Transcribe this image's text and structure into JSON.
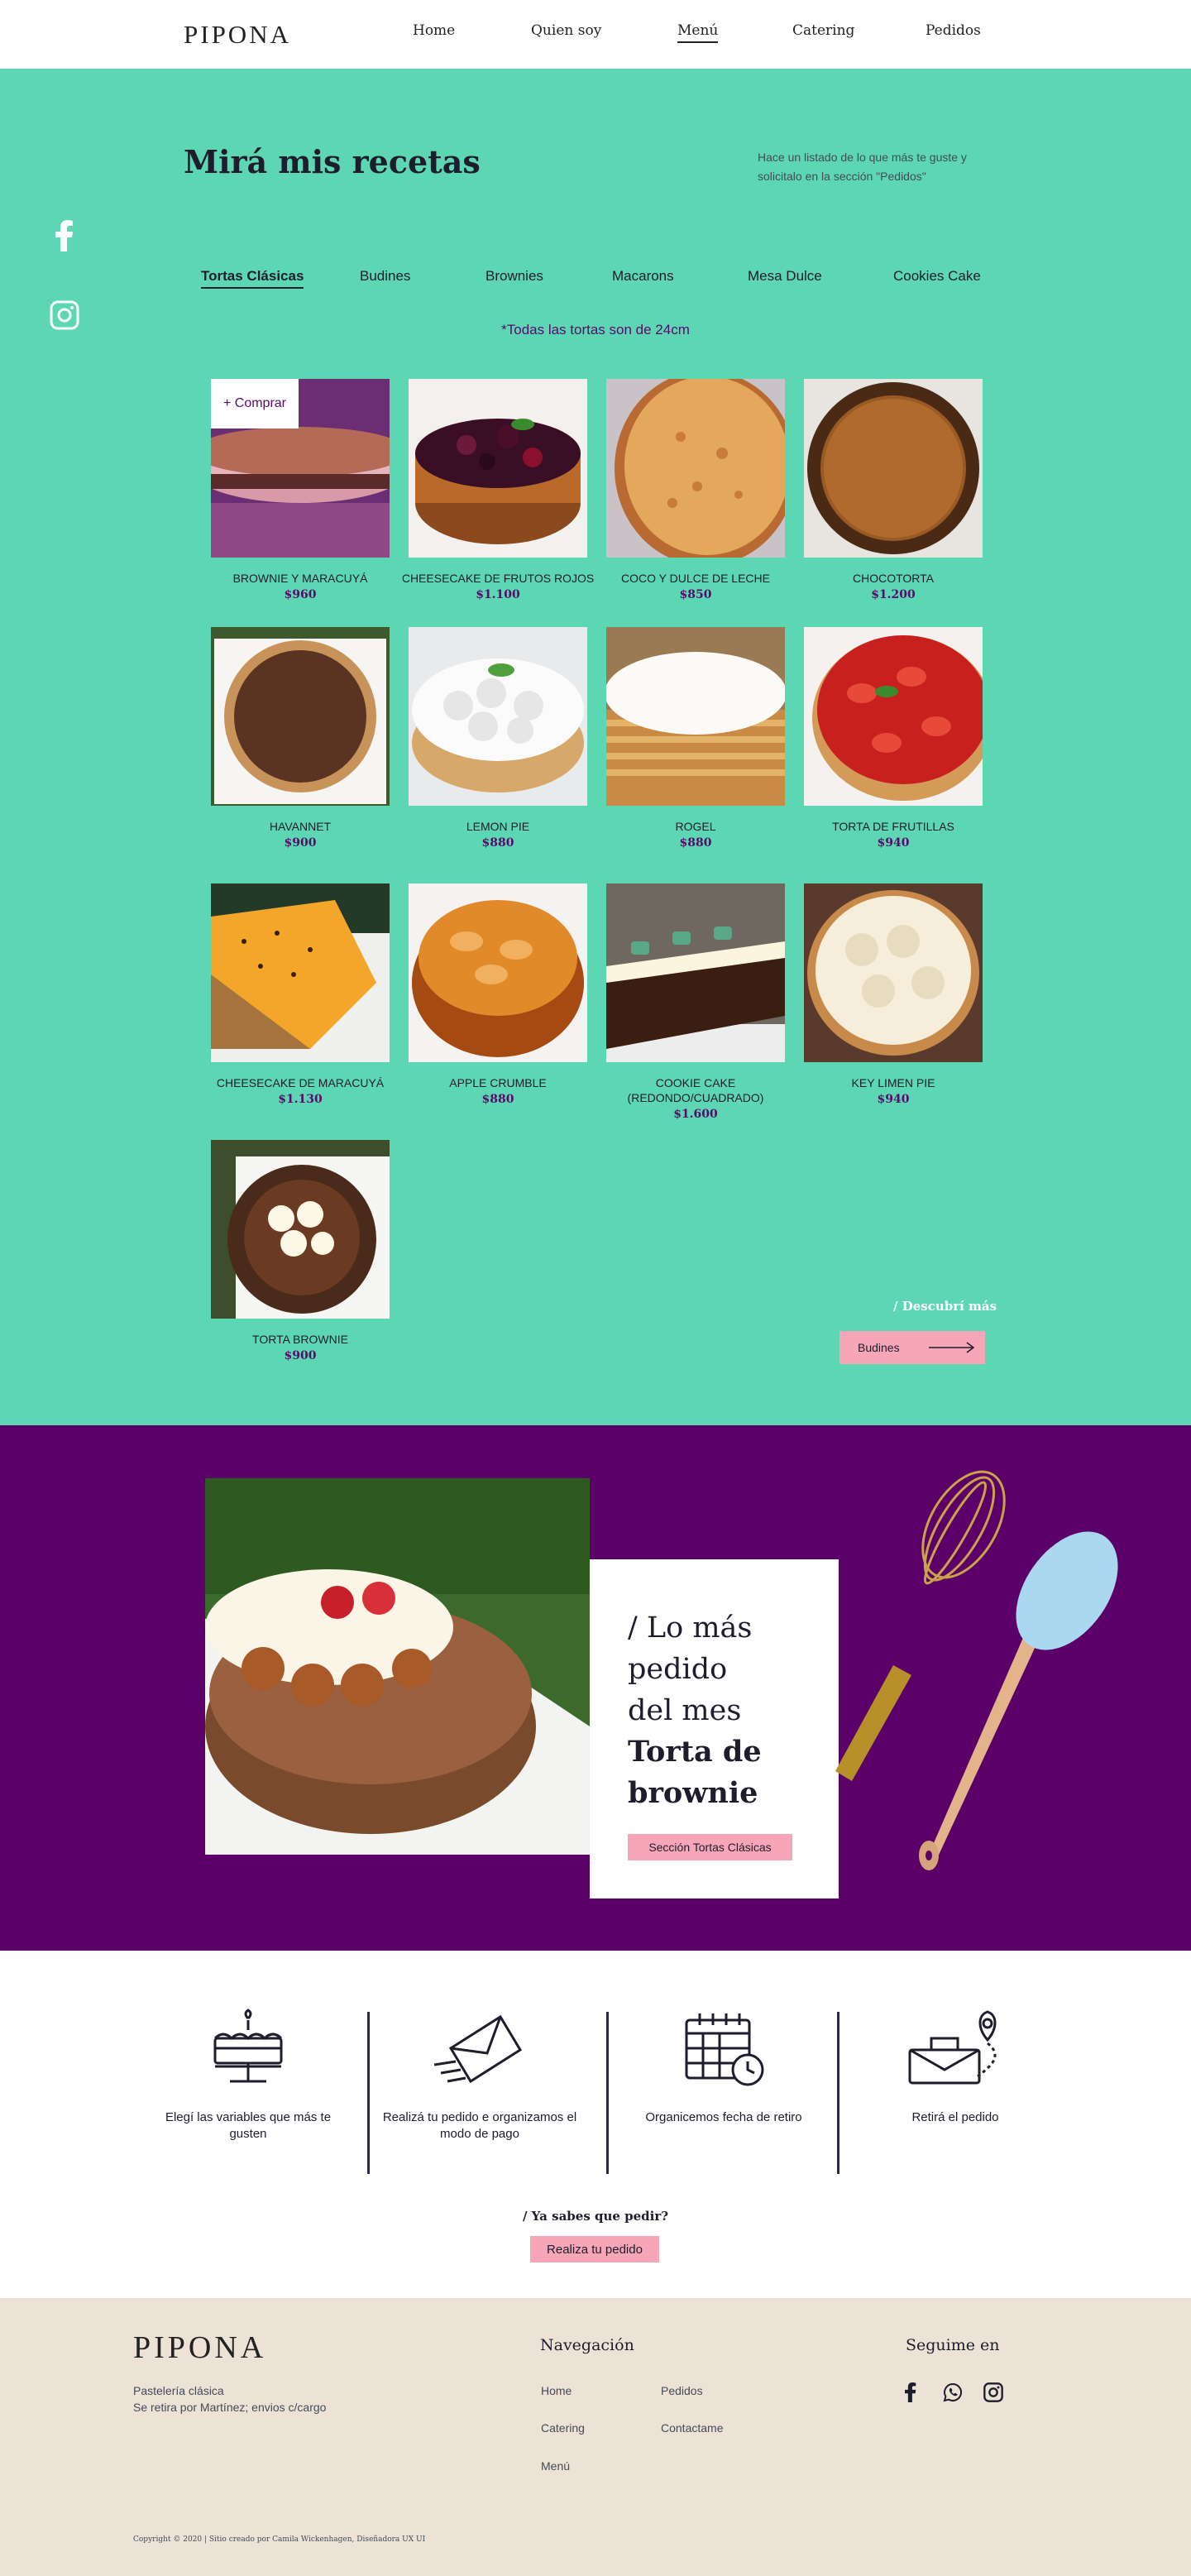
{
  "header": {
    "logo": "PIPONA",
    "nav": [
      {
        "label": "Home"
      },
      {
        "label": "Quien soy"
      },
      {
        "label": "Menú"
      },
      {
        "label": "Catering"
      },
      {
        "label": "Pedidos"
      }
    ],
    "active_nav": "Menú"
  },
  "menu": {
    "title": "Mirá mis recetas",
    "intro": "Hace un listado de lo que más te guste y solicitalo en la sección \"Pedidos\"",
    "tabs": [
      {
        "label": "Tortas Clásicas"
      },
      {
        "label": "Budines"
      },
      {
        "label": "Brownies"
      },
      {
        "label": "Macarons"
      },
      {
        "label": "Mesa Dulce"
      },
      {
        "label": "Cookies Cake"
      }
    ],
    "active_tab": "Tortas Clásicas",
    "size_note": "*Todas las tortas son de 24cm",
    "buy_label": "+ Comprar",
    "products": [
      {
        "name": "BROWNIE Y MARACUYÁ",
        "price": "$960"
      },
      {
        "name": "CHEESECAKE DE FRUTOS ROJOS",
        "price": "$1.100"
      },
      {
        "name": "COCO Y DULCE DE LECHE",
        "price": "$850"
      },
      {
        "name": "CHOCOTORTA",
        "price": "$1.200"
      },
      {
        "name": "HAVANNET",
        "price": "$900"
      },
      {
        "name": "LEMON PIE",
        "price": "$880"
      },
      {
        "name": "ROGEL",
        "price": "$880"
      },
      {
        "name": "TORTA DE FRUTILLAS",
        "price": "$940"
      },
      {
        "name": "CHEESECAKE DE MARACUYÁ",
        "price": "$1.130"
      },
      {
        "name": "APPLE CRUMBLE",
        "price": "$880"
      },
      {
        "name": "COOKIE CAKE (REDONDO/CUADRADO)",
        "price": "$1.600"
      },
      {
        "name": "KEY LIMEN PIE",
        "price": "$940"
      },
      {
        "name": "TORTA BROWNIE",
        "price": "$900"
      }
    ],
    "discover_label": "/ Descubrí más",
    "next_button": "Budines"
  },
  "featured": {
    "line1": "/ Lo más",
    "line2": "pedido",
    "line3": "del mes",
    "line4": "Torta de",
    "line5": "brownie",
    "button": "Sección Tortas Clásicas"
  },
  "steps": {
    "items": [
      {
        "text": "Elegí las variables que más te gusten",
        "icon": "cake-icon"
      },
      {
        "text": "Realizá tu pedido e organizamos el modo de pago",
        "icon": "envelope-icon"
      },
      {
        "text": "Organicemos fecha de retiro",
        "icon": "calendar-icon"
      },
      {
        "text": "Retirá el pedido",
        "icon": "delivery-icon"
      }
    ],
    "question": "/ Ya sabes que pedir?",
    "button": "Realiza tu pedido"
  },
  "footer": {
    "logo": "PIPONA",
    "tagline": "Pastelería clásica",
    "pickup": "Se retira por Martínez; envios c/cargo",
    "nav_heading": "Navegación",
    "links": {
      "home": "Home",
      "pedidos": "Pedidos",
      "catering": "Catering",
      "contactame": "Contactame",
      "menu": "Menú"
    },
    "follow_heading": "Seguime en",
    "copyright": "Copyright © 2020 | Sitio creado por Camila Wickenhagen, Diseñadora UX UI"
  },
  "colors": {
    "mint": "#5dd6b4",
    "purple": "#5b0068",
    "pink": "#f7a6b8",
    "beige": "#ece2d6"
  }
}
